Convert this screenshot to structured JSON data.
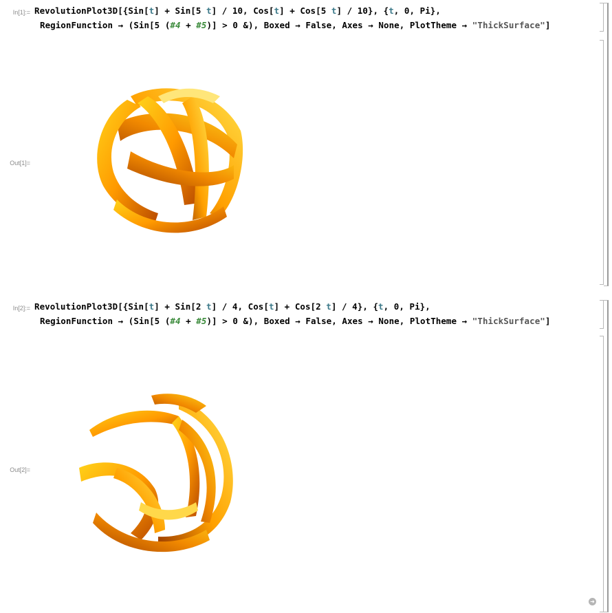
{
  "cells": [
    {
      "in_label": "In[1]:=",
      "out_label": "Out[1]=",
      "line1": [
        {
          "t": "RevolutionPlot3D[{Sin[",
          "c": ""
        },
        {
          "t": "t",
          "c": "var"
        },
        {
          "t": "] + Sin[5 ",
          "c": ""
        },
        {
          "t": "t",
          "c": "var"
        },
        {
          "t": "] / 10, Cos[",
          "c": ""
        },
        {
          "t": "t",
          "c": "var"
        },
        {
          "t": "] + Cos[5 ",
          "c": ""
        },
        {
          "t": "t",
          "c": "var"
        },
        {
          "t": "] / 10}, {",
          "c": ""
        },
        {
          "t": "t",
          "c": "var"
        },
        {
          "t": ", 0, Pi},",
          "c": ""
        }
      ],
      "line2": [
        {
          "t": "RegionFunction → (Sin[5 (",
          "c": ""
        },
        {
          "t": "#4",
          "c": "slot"
        },
        {
          "t": " + ",
          "c": ""
        },
        {
          "t": "#5",
          "c": "slot"
        },
        {
          "t": ")] > 0 &), Boxed → False, Axes → None, PlotTheme → ",
          "c": ""
        },
        {
          "t": "\"ThickSurface\"",
          "c": "str"
        },
        {
          "t": "]",
          "c": ""
        }
      ]
    },
    {
      "in_label": "In[2]:=",
      "out_label": "Out[2]=",
      "line1": [
        {
          "t": "RevolutionPlot3D[{Sin[",
          "c": ""
        },
        {
          "t": "t",
          "c": "var"
        },
        {
          "t": "] + Sin[2 ",
          "c": ""
        },
        {
          "t": "t",
          "c": "var"
        },
        {
          "t": "] / 4, Cos[",
          "c": ""
        },
        {
          "t": "t",
          "c": "var"
        },
        {
          "t": "] + Cos[2 ",
          "c": ""
        },
        {
          "t": "t",
          "c": "var"
        },
        {
          "t": "] / 4}, {",
          "c": ""
        },
        {
          "t": "t",
          "c": "var"
        },
        {
          "t": ", 0, Pi},",
          "c": ""
        }
      ],
      "line2": [
        {
          "t": "RegionFunction → (Sin[5 (",
          "c": ""
        },
        {
          "t": "#4",
          "c": "slot"
        },
        {
          "t": " + ",
          "c": ""
        },
        {
          "t": "#5",
          "c": "slot"
        },
        {
          "t": ")] > 0 &), Boxed → False, Axes → None, PlotTheme → ",
          "c": ""
        },
        {
          "t": "\"ThickSurface\"",
          "c": "str"
        },
        {
          "t": "]",
          "c": ""
        }
      ]
    }
  ],
  "colors": {
    "surface_light": "#ffd21a",
    "surface_mid": "#ff9a00",
    "surface_dark": "#b84a00"
  },
  "icons": {
    "return": "circle-arrow-icon"
  }
}
